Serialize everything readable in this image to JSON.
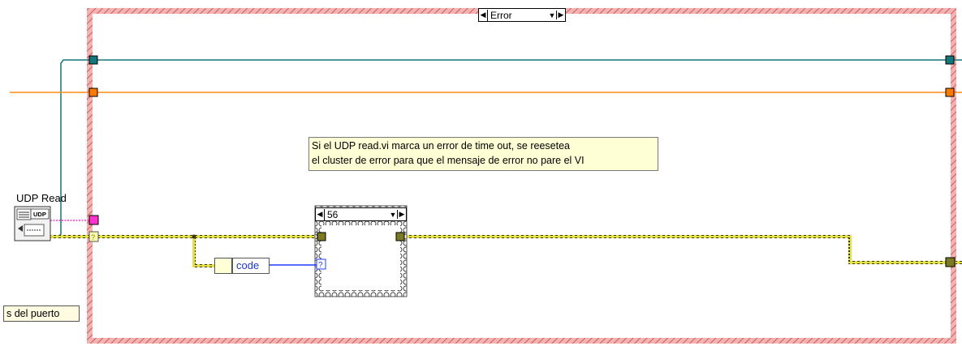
{
  "outer_case": {
    "selector_value": "Error"
  },
  "inner_case": {
    "selector_value": "56"
  },
  "comment": {
    "line1": "Si el UDP read.vi  marca un error de time out, se reesetea",
    "line2": "el cluster de error para que el mensaje de error no pare el VI"
  },
  "udp_read": {
    "label": "UDP Read",
    "icon_text": "UDP"
  },
  "unbundle": {
    "field": "code"
  },
  "port_label": {
    "text": "s del puerto"
  },
  "colors": {
    "error_wire": "#7a7a00",
    "teal_wire": "#13767a",
    "orange_wire": "#ff8c1a",
    "case_border": "#e06a6a",
    "number_wire": "#1f3cff"
  }
}
